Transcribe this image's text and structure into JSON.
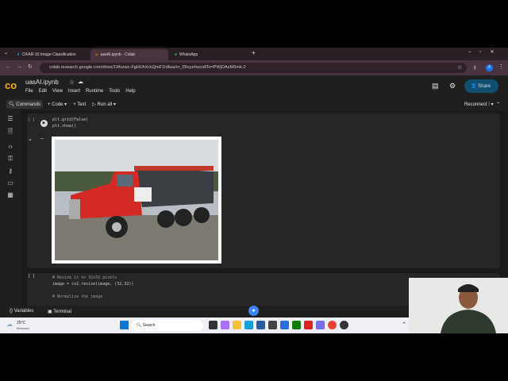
{
  "browser": {
    "tabs": [
      {
        "title": "CIFAR-10 Image Classification",
        "active": false
      },
      {
        "title": "uasAI.ipynb - Colab",
        "active": true
      },
      {
        "title": "WhatsApp",
        "active": false
      }
    ],
    "url": "colab.research.google.com/drive/1Wvzwc-FgHUhXckQmF1h8wa/vr_f3Ivyz#scrollTo=PWjOAsNRmk-2"
  },
  "colab": {
    "notebook_title": "uasAI.ipynb",
    "menu": [
      "File",
      "Edit",
      "View",
      "Insert",
      "Runtime",
      "Tools",
      "Help"
    ],
    "share_label": "Share",
    "toolbar": {
      "commands": "Commands",
      "code": "Code",
      "text": "Text",
      "run_all": "Run all",
      "reconnect": "Reconnect"
    },
    "cells": [
      {
        "bracket": "[ ]",
        "lines": [
          "plt.grid(False)",
          "plt.show()"
        ]
      },
      {
        "bracket": "[ ]",
        "lines": [
          "# Resize it to 32x32 pixels",
          "image = cv2.resize(image, (32,32))",
          "",
          "# Normalize the image"
        ]
      }
    ],
    "output_image_label": "Red dump truck"
  },
  "bottom": {
    "variables": "Variables",
    "terminal": "Terminal"
  },
  "taskbar": {
    "temp": "25°C",
    "weather": "Berawan",
    "search": "Search"
  },
  "colors": {
    "accent": "#0b57d0",
    "share_bg": "#114f6e"
  }
}
